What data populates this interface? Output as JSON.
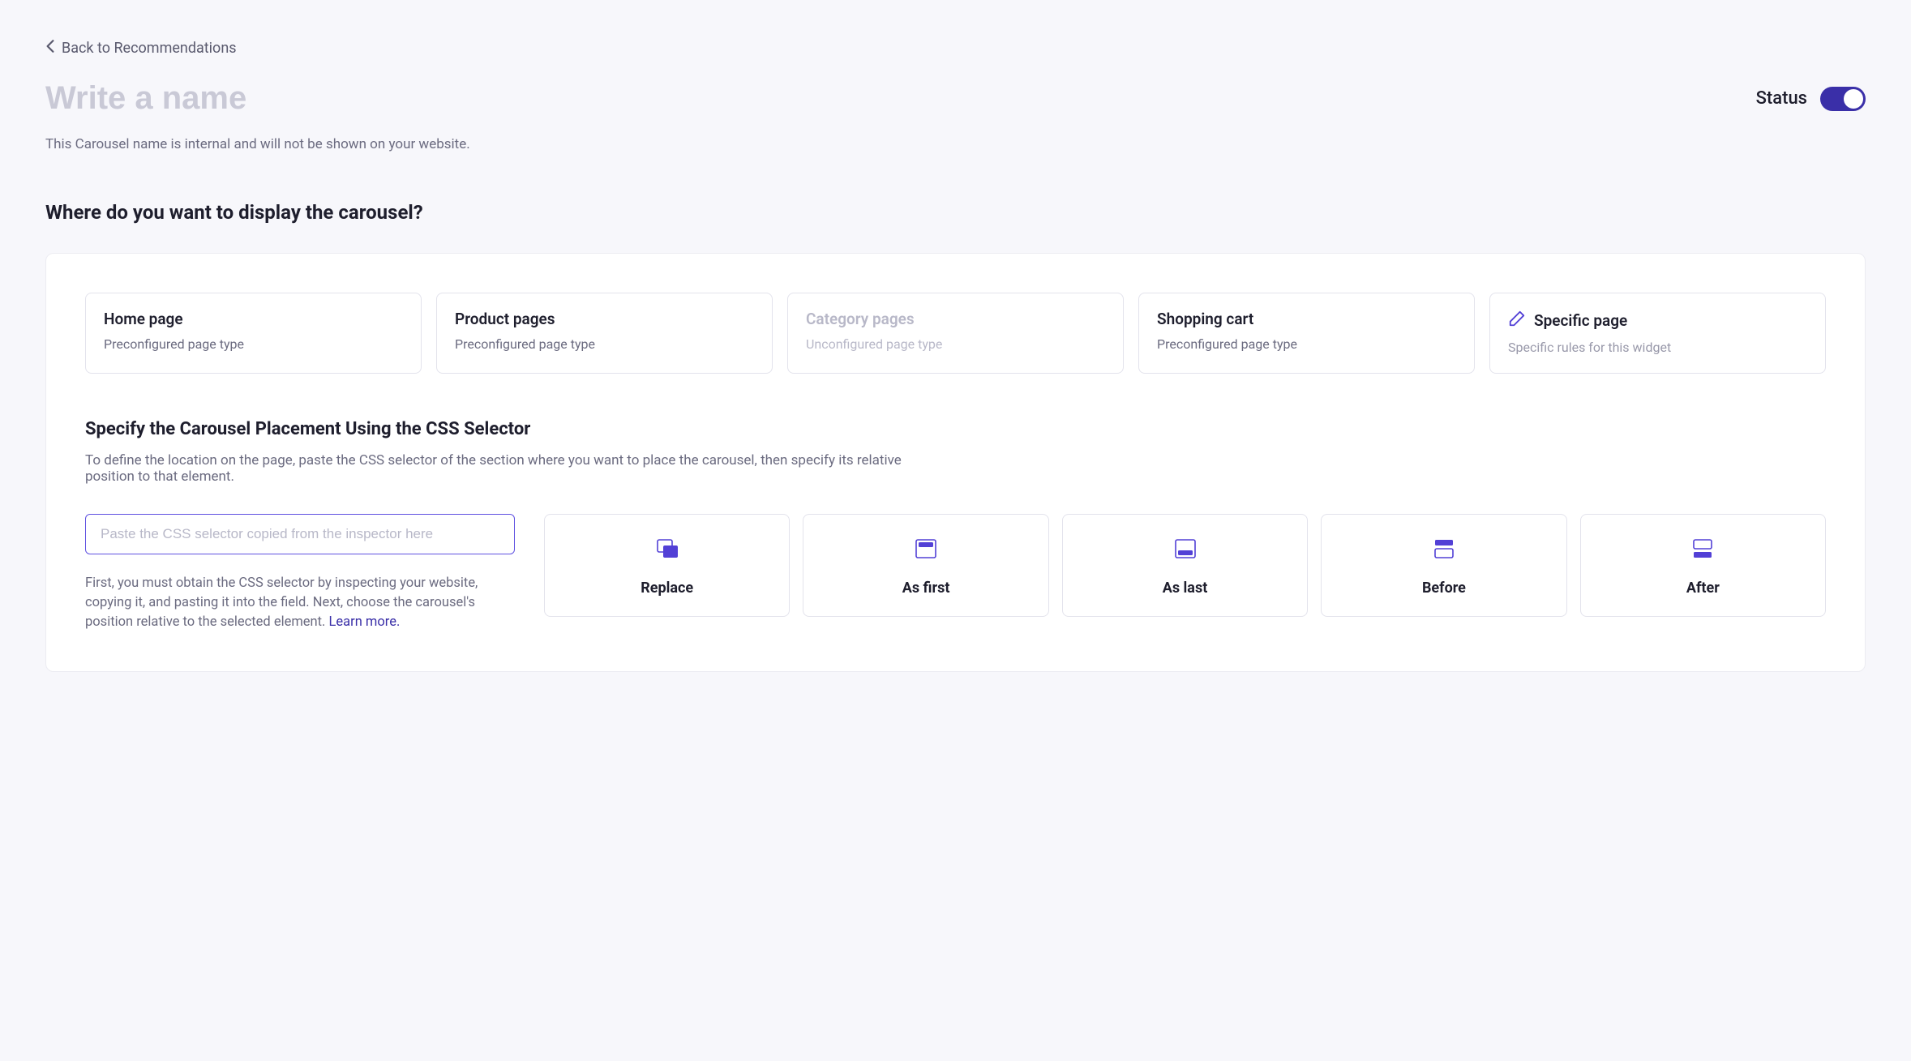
{
  "back_link": "Back to Recommendations",
  "name_input": {
    "placeholder": "Write a name",
    "value": ""
  },
  "name_help": "This Carousel name is internal and will not be shown on your website.",
  "status": {
    "label": "Status",
    "on": true
  },
  "section_heading": "Where do you want to display the carousel?",
  "page_types": [
    {
      "id": "home",
      "title": "Home page",
      "sub": "Preconfigured page type",
      "configured": true,
      "icon": null
    },
    {
      "id": "product",
      "title": "Product pages",
      "sub": "Preconfigured page type",
      "configured": true,
      "icon": null
    },
    {
      "id": "category",
      "title": "Category pages",
      "sub": "Unconfigured page type",
      "configured": false,
      "icon": null
    },
    {
      "id": "cart",
      "title": "Shopping cart",
      "sub": "Preconfigured page type",
      "configured": true,
      "icon": null
    },
    {
      "id": "specific",
      "title": "Specific page",
      "sub": "Specific rules for this widget",
      "configured": true,
      "icon": "pencil-icon"
    }
  ],
  "placement": {
    "heading": "Specify the Carousel Placement Using the CSS Selector",
    "description": "To define the location on the page, paste the CSS selector of the section where you want to place the carousel, then specify its relative position to that element.",
    "input_placeholder": "Paste the CSS selector copied from the inspector here",
    "input_value": "",
    "help_text": "First, you must obtain the CSS selector by inspecting your website, copying it, and pasting it into the field. Next, choose the carousel's position relative to the selected element. ",
    "learn_more": "Learn more."
  },
  "positions": [
    {
      "id": "replace",
      "label": "Replace",
      "icon": "replace-icon"
    },
    {
      "id": "as-first",
      "label": "As first",
      "icon": "as-first-icon"
    },
    {
      "id": "as-last",
      "label": "As last",
      "icon": "as-last-icon"
    },
    {
      "id": "before",
      "label": "Before",
      "icon": "before-icon"
    },
    {
      "id": "after",
      "label": "After",
      "icon": "after-icon"
    }
  ],
  "colors": {
    "accent": "#3a2fa8",
    "icon_accent": "#5240d6"
  }
}
